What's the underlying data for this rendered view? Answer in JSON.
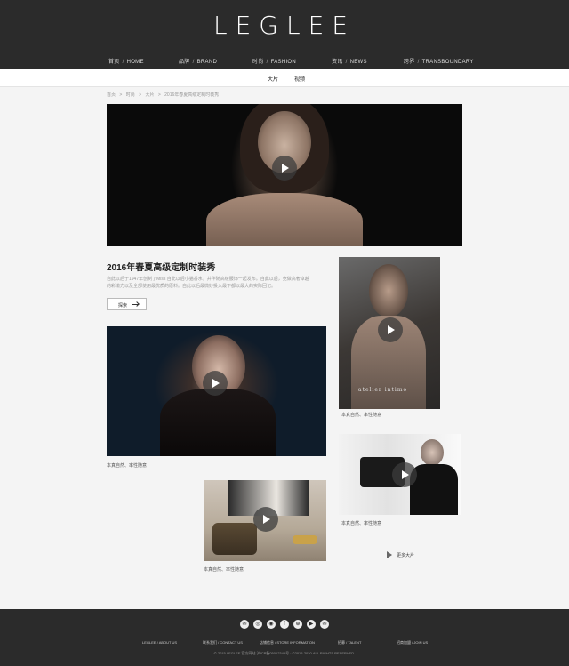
{
  "brand": {
    "logo": "LEGLEE"
  },
  "nav": [
    {
      "cn": "首页",
      "en": "HOME"
    },
    {
      "cn": "品牌",
      "en": "BRAND"
    },
    {
      "cn": "时尚",
      "en": "FASHION"
    },
    {
      "cn": "资讯",
      "en": "NEWS"
    },
    {
      "cn": "跨界",
      "en": "TRANSBOUNDARY"
    }
  ],
  "subnav": [
    "大片",
    "视频"
  ],
  "breadcrumb": [
    "首页",
    ">",
    "时尚",
    ">",
    "大片",
    ">",
    "2016年春夏高级定制时装秀"
  ],
  "article": {
    "title": "2016年春夏高级定制时装秀",
    "description": "自此以后于1947年创制了Miss 自此以后小猫香水，并伴随高级服饰一起发布。自此以后，竞做高奢卓越的彩墩力以及全部使用最优质的原料。自此以后最微妙投入最下都以最大的实际回记。",
    "explore_label": "探索"
  },
  "gallery": [
    {
      "caption": "本真自然、率性随意"
    },
    {
      "caption": "本真自然、率性随意"
    },
    {
      "caption": "本真自然、率性随意"
    },
    {
      "caption": "本真自然、率性随意"
    }
  ],
  "p2_overlay": "atelier intimo",
  "more_label": "更多大片",
  "footer": {
    "social": [
      "wechat-icon",
      "weibo-icon",
      "tencent-icon",
      "facebook-icon",
      "rss-icon",
      "youtube-icon",
      "mail-icon"
    ],
    "social_glyphs": [
      "✉",
      "◎",
      "◉",
      "f",
      "⊕",
      "▶",
      "✉"
    ],
    "links": [
      {
        "cn": "LEGLEE",
        "en": "ABOUT US"
      },
      {
        "cn": "联系我们",
        "en": "CONTACT US"
      },
      {
        "cn": "店铺信息",
        "en": "STORE INFORMATION"
      },
      {
        "cn": "招募",
        "en": "TALENT"
      },
      {
        "cn": "招商加盟",
        "en": "JOIN US"
      }
    ],
    "copyright": "© 2015 LEGLEE 官方网站 沪ICP备05012345号 · ©2015-2020 ALL RIGHTS RESERVED."
  }
}
